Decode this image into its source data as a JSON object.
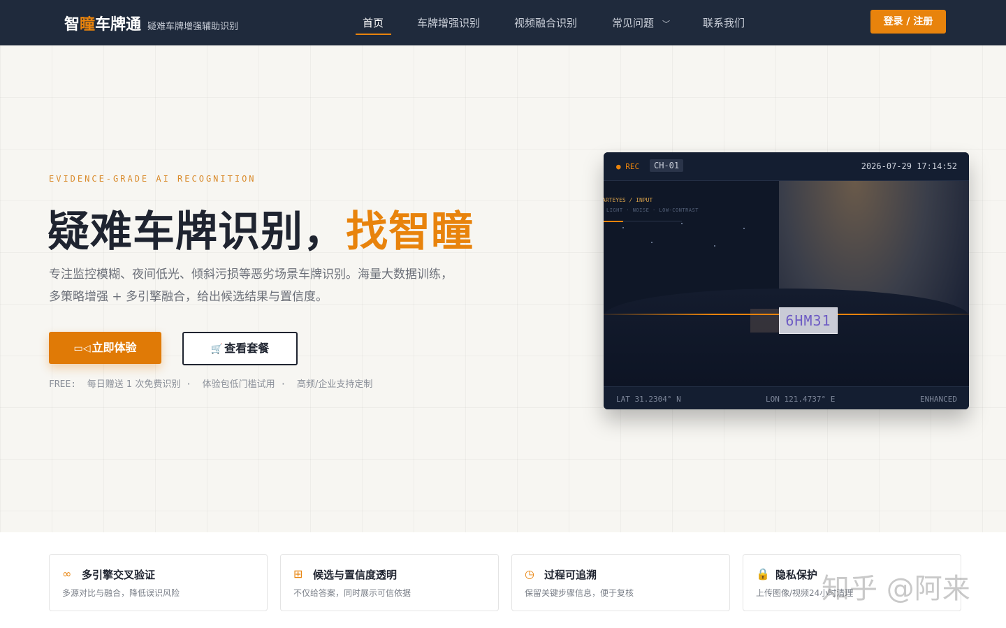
{
  "brand": {
    "name_part1": "智",
    "name_accent": "瞳",
    "name_part2": "车牌通",
    "subtitle": "疑难车牌增强辅助识别"
  },
  "nav": {
    "items": [
      {
        "label": "首页",
        "active": true
      },
      {
        "label": "车牌增强识别",
        "active": false
      },
      {
        "label": "视频融合识别",
        "active": false
      },
      {
        "label": "常见问题",
        "active": false,
        "dropdown": true
      },
      {
        "label": "联系我们",
        "active": false
      }
    ],
    "login_label": "登录 / 注册"
  },
  "hero": {
    "eyebrow": "EVIDENCE-GRADE AI RECOGNITION",
    "headline_main": "疑难车牌识别，",
    "headline_accent": "找智瞳",
    "description": "专注监控模糊、夜间低光、倾斜污损等恶劣场景车牌识别。海量大数据训练，多策略增强 + 多引擎融合，给出候选结果与置信度。",
    "primary_button": "立即体验",
    "secondary_button": "查看套餐",
    "free_label": "FREE:",
    "free_items": [
      "每日赠送 1 次免费识别",
      "体验包低门槛试用",
      "高频/企业支持定制"
    ]
  },
  "camera": {
    "rec_label": "● REC",
    "channel": "CH-01",
    "timestamp": "2026-07-29 17:14:52",
    "overlay_title": "ARTEYES / INPUT",
    "overlay_sub": "LIGHT · NOISE · LOW-CONTRAST",
    "plate_text": "6HM31",
    "lat": "LAT 31.2304° N",
    "lon": "LON 121.4737° E",
    "status": "ENHANCED"
  },
  "features": [
    {
      "icon": "link-icon",
      "title": "多引擎交叉验证",
      "desc": "多源对比与融合，降低误识风险"
    },
    {
      "icon": "chart-board-icon",
      "title": "候选与置信度透明",
      "desc": "不仅给答案，同时展示可信依据"
    },
    {
      "icon": "clock-icon",
      "title": "过程可追溯",
      "desc": "保留关键步骤信息，便于复核"
    },
    {
      "icon": "lock-icon",
      "title": "隐私保护",
      "desc": "上传图像/视频24小时清理"
    }
  ],
  "watermark": "知乎 @阿来",
  "colors": {
    "accent": "#e8830c",
    "navbar": "#1f2a3c",
    "camera_bg": "#111a2c"
  }
}
